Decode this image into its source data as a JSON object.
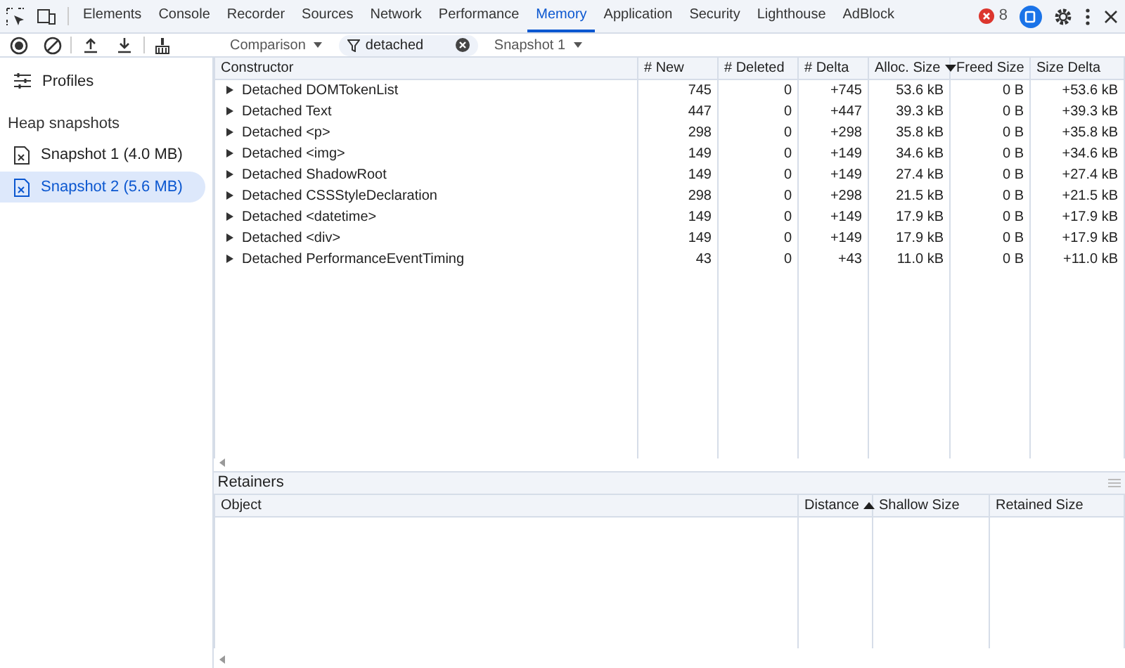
{
  "tabs": [
    {
      "label": "Elements",
      "selected": false
    },
    {
      "label": "Console",
      "selected": false
    },
    {
      "label": "Recorder",
      "selected": false
    },
    {
      "label": "Sources",
      "selected": false
    },
    {
      "label": "Network",
      "selected": false
    },
    {
      "label": "Performance",
      "selected": false
    },
    {
      "label": "Memory",
      "selected": true
    },
    {
      "label": "Application",
      "selected": false
    },
    {
      "label": "Security",
      "selected": false
    },
    {
      "label": "Lighthouse",
      "selected": false
    },
    {
      "label": "AdBlock",
      "selected": false
    }
  ],
  "error_count": "8",
  "toolbar": {
    "view": "Comparison",
    "filter": "detached",
    "base": "Snapshot 1"
  },
  "sidebar": {
    "profiles_label": "Profiles",
    "section": "Heap snapshots",
    "snapshots": [
      {
        "label": "Snapshot 1 (4.0 MB)",
        "selected": false
      },
      {
        "label": "Snapshot 2 (5.6 MB)",
        "selected": true
      }
    ]
  },
  "table": {
    "columns": [
      {
        "label": "Constructor",
        "sorted": false
      },
      {
        "label": "# New",
        "sorted": false
      },
      {
        "label": "# Deleted",
        "sorted": false
      },
      {
        "label": "# Delta",
        "sorted": false
      },
      {
        "label": "Alloc. Size",
        "sorted": true,
        "ascending": false
      },
      {
        "label": "Freed Size",
        "sorted": false
      },
      {
        "label": "Size Delta",
        "sorted": false
      }
    ],
    "rows": [
      [
        "Detached DOMTokenList",
        "745",
        "0",
        "+745",
        "53.6 kB",
        "0 B",
        "+53.6 kB"
      ],
      [
        "Detached Text",
        "447",
        "0",
        "+447",
        "39.3 kB",
        "0 B",
        "+39.3 kB"
      ],
      [
        "Detached <p>",
        "298",
        "0",
        "+298",
        "35.8 kB",
        "0 B",
        "+35.8 kB"
      ],
      [
        "Detached <img>",
        "149",
        "0",
        "+149",
        "34.6 kB",
        "0 B",
        "+34.6 kB"
      ],
      [
        "Detached ShadowRoot",
        "149",
        "0",
        "+149",
        "27.4 kB",
        "0 B",
        "+27.4 kB"
      ],
      [
        "Detached CSSStyleDeclaration",
        "298",
        "0",
        "+298",
        "21.5 kB",
        "0 B",
        "+21.5 kB"
      ],
      [
        "Detached <datetime>",
        "149",
        "0",
        "+149",
        "17.9 kB",
        "0 B",
        "+17.9 kB"
      ],
      [
        "Detached <div>",
        "149",
        "0",
        "+149",
        "17.9 kB",
        "0 B",
        "+17.9 kB"
      ],
      [
        "Detached PerformanceEventTiming",
        "43",
        "0",
        "+43",
        "11.0 kB",
        "0 B",
        "+11.0 kB"
      ]
    ]
  },
  "retainers": {
    "title": "Retainers",
    "columns": [
      {
        "label": "Object",
        "sorted": false
      },
      {
        "label": "Distance",
        "sorted": true,
        "ascending": true
      },
      {
        "label": "Shallow Size",
        "sorted": false
      },
      {
        "label": "Retained Size",
        "sorted": false
      }
    ]
  }
}
